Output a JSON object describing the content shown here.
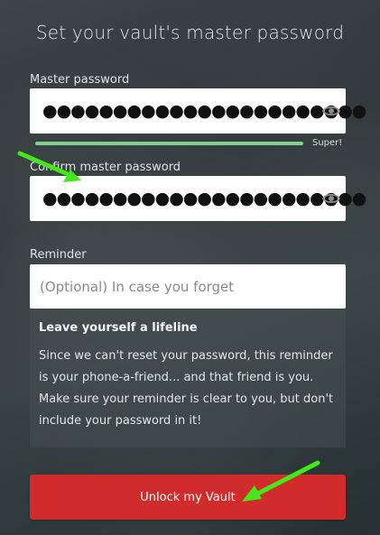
{
  "title": "Set your vault's master password",
  "master": {
    "label": "Master password",
    "masked_value": "●●●●●●●●●●●●●●●●●●●●●●●",
    "strength_label": "Super!",
    "strength_fraction": 1.0
  },
  "confirm": {
    "label": "Confirm master password",
    "masked_value": "●●●●●●●●●●●●●●●●●●●●●●●"
  },
  "reminder": {
    "label": "Reminder",
    "placeholder": "(Optional) In case you forget"
  },
  "hint": {
    "title": "Leave yourself a lifeline",
    "body": "Since we can't reset your password, this reminder is your phone-a-friend... and that friend is you. Make sure your reminder is clear to you, but don't include your password in it!"
  },
  "unlock_button": "Unlock my Vault",
  "colors": {
    "accent": "#d12b2b",
    "strength": "#7fd18b",
    "annotation_arrow": "#44e81a"
  },
  "icons": {
    "reveal": "eye-icon",
    "annotation": "arrow-annotation"
  }
}
